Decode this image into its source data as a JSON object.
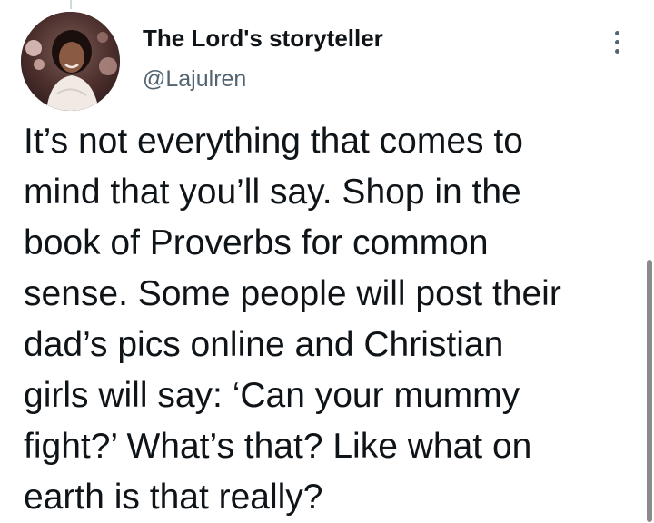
{
  "tweet": {
    "display_name": "The Lord's storyteller",
    "handle": "@Lajulren",
    "text_lines": [
      "It’s not everything that comes to",
      "mind that you’ll say. Shop in the",
      "book of Proverbs for common",
      "sense. Some people will post their",
      "dad’s pics online and Christian",
      "girls will say: ‘Can your mummy",
      "fight?’ What’s that? Like what on",
      "earth is that really?"
    ],
    "more_icon": "more-vertical-icon"
  },
  "colors": {
    "text_primary": "#0f1419",
    "text_secondary": "#536471",
    "background": "#ffffff",
    "scrollbar": "#8a8a8a"
  }
}
